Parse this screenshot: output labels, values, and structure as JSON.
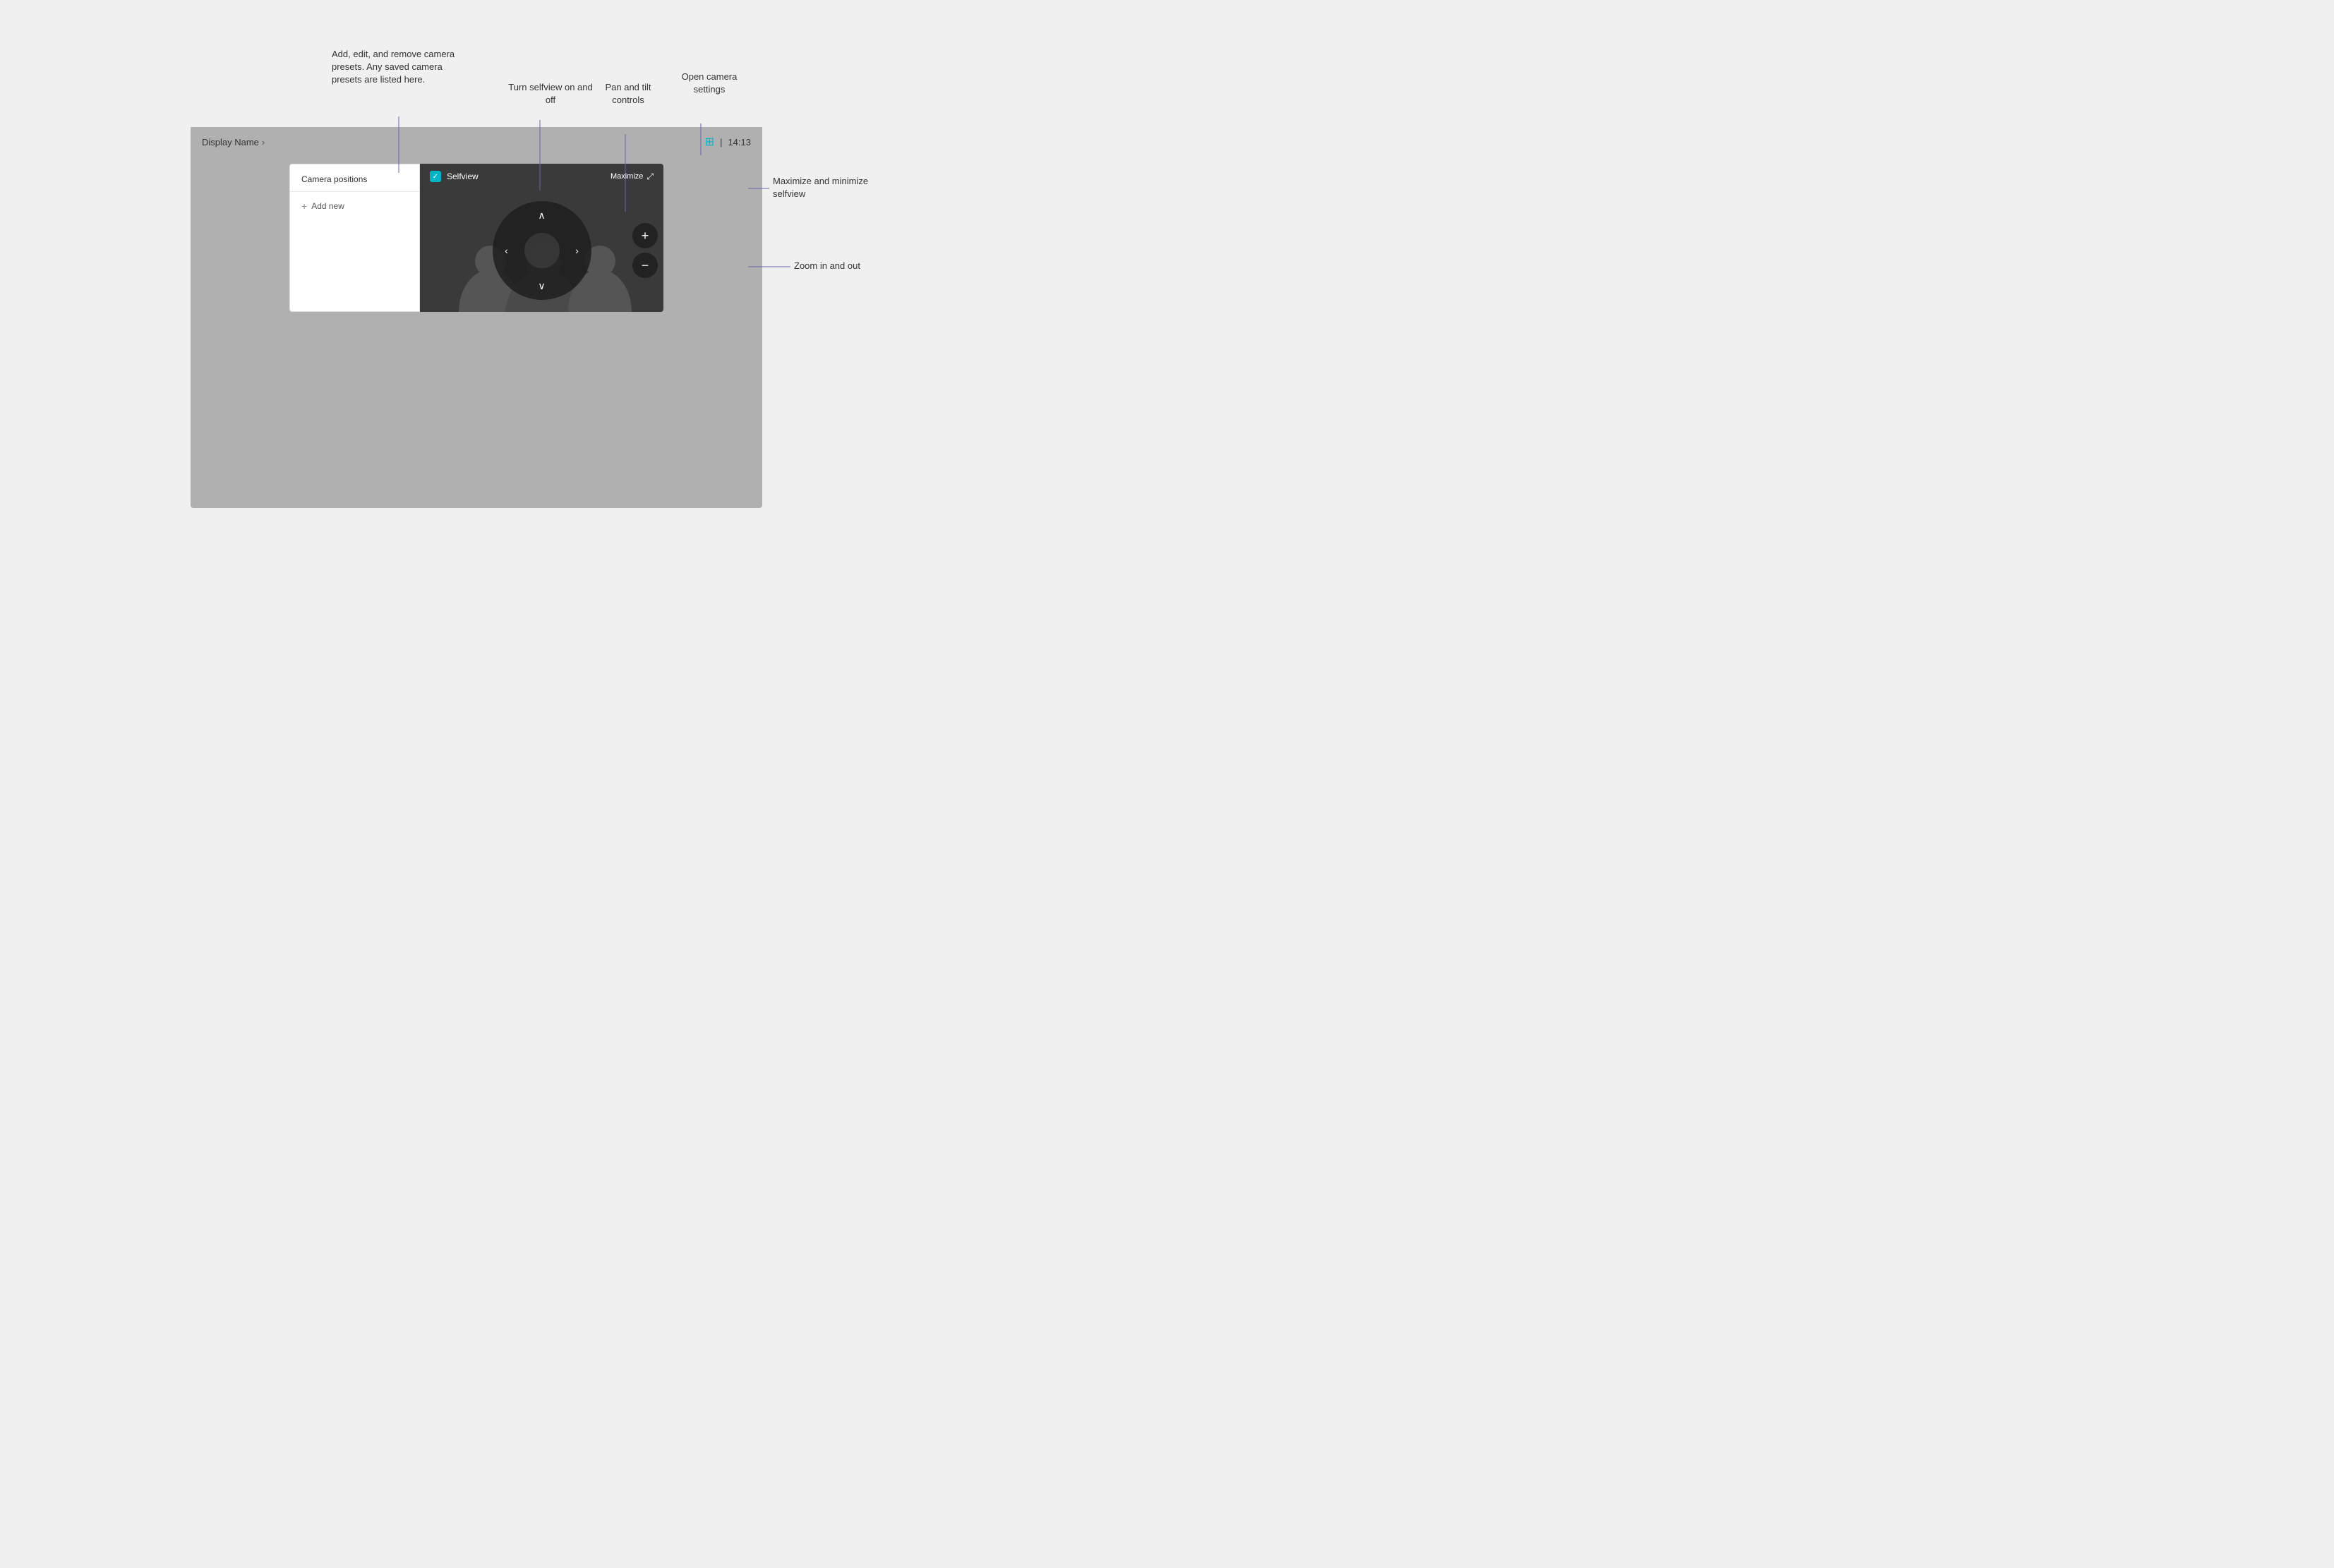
{
  "device": {
    "display_name": "Display Name",
    "chevron": "›",
    "time": "14:13",
    "separator": "|"
  },
  "camera_positions": {
    "header": "Camera positions",
    "add_new": "Add new"
  },
  "selfview": {
    "label": "Selfview",
    "maximize": "Maximize",
    "checked": "✓"
  },
  "pan_tilt": {
    "up": "∧",
    "down": "∨",
    "left": "‹",
    "right": "›"
  },
  "zoom": {
    "in": "+",
    "out": "−"
  },
  "annotations": {
    "camera_presets": "Add, edit, and remove\ncamera presets.\nAny saved camera\npresets are listed here.",
    "selfview_toggle": "Turn selfview\non and off",
    "pan_tilt": "Pan and\ntilt controls",
    "camera_settings": "Open camera\nsettings",
    "maximize": "Maximize and\nminimize selfview",
    "zoom": "Zoom in and out"
  }
}
